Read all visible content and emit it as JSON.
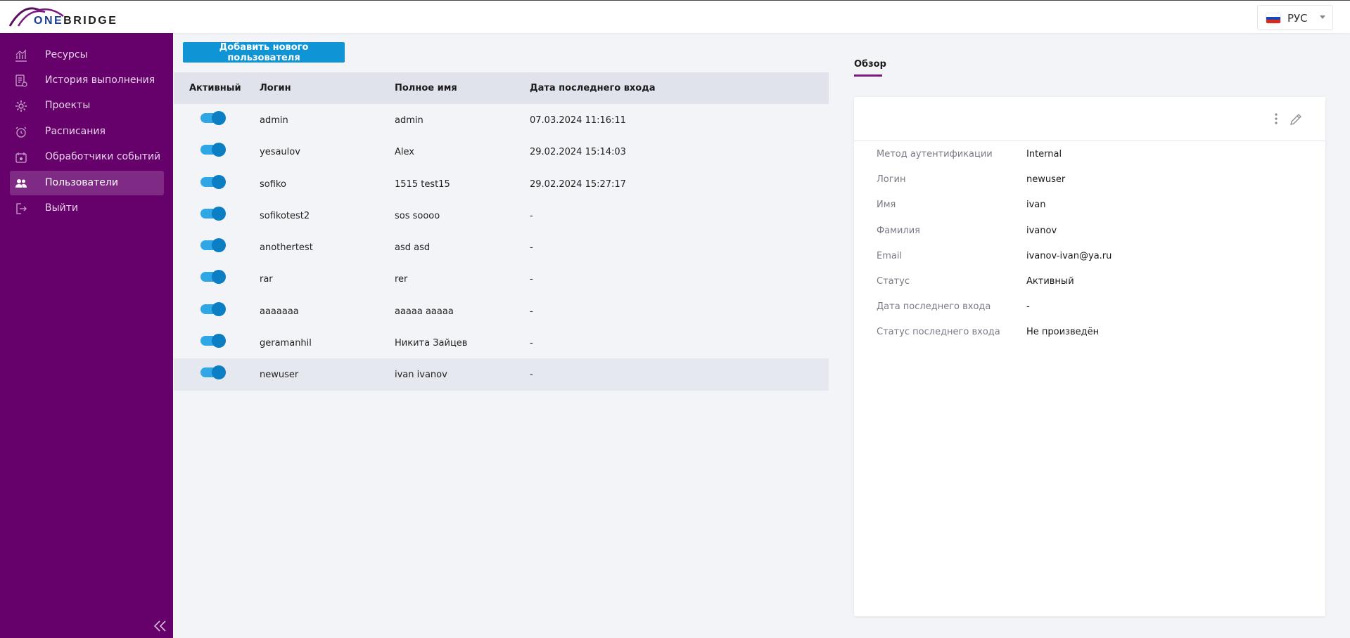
{
  "app": {
    "logo_one": "ONE",
    "logo_bridge": "BRIDGE"
  },
  "language": {
    "label": "РУС"
  },
  "sidebar": {
    "items": [
      {
        "label": "Ресурсы",
        "icon": "chart-icon"
      },
      {
        "label": "История выполнения",
        "icon": "history-icon"
      },
      {
        "label": "Проекты",
        "icon": "gear-icon"
      },
      {
        "label": "Расписания",
        "icon": "alarm-clock-icon"
      },
      {
        "label": "Обработчики событий",
        "icon": "event-icon"
      },
      {
        "label": "Пользователи",
        "icon": "users-icon",
        "active": true
      },
      {
        "label": "Выйти",
        "icon": "logout-icon"
      }
    ]
  },
  "toolbar": {
    "add_user_label": "Добавить нового пользователя"
  },
  "table": {
    "headers": {
      "active": "Активный",
      "login": "Логин",
      "full_name": "Полное имя",
      "last_login": "Дата последнего входа"
    },
    "rows": [
      {
        "active": true,
        "login": "admin",
        "full_name": "admin",
        "last_login": "07.03.2024 11:16:11"
      },
      {
        "active": true,
        "login": "yesaulov",
        "full_name": "Alex",
        "last_login": "29.02.2024 15:14:03"
      },
      {
        "active": true,
        "login": "sofiko",
        "full_name": "1515 test15",
        "last_login": "29.02.2024 15:27:17"
      },
      {
        "active": true,
        "login": "sofikotest2",
        "full_name": "sos soooo",
        "last_login": "-"
      },
      {
        "active": true,
        "login": "anothertest",
        "full_name": "asd asd",
        "last_login": "-"
      },
      {
        "active": true,
        "login": "rar",
        "full_name": "rer",
        "last_login": "-"
      },
      {
        "active": true,
        "login": "aaaaaaa",
        "full_name": "aaaaa aaaaa",
        "last_login": "-"
      },
      {
        "active": true,
        "login": "geramanhil",
        "full_name": "Никита Зайцев",
        "last_login": "-"
      },
      {
        "active": true,
        "login": "newuser",
        "full_name": "ivan ivanov",
        "last_login": "-",
        "selected": true
      }
    ]
  },
  "details": {
    "tab_label": "Обзор",
    "fields": [
      {
        "label": "Метод аутентификации",
        "value": "Internal"
      },
      {
        "label": "Логин",
        "value": "newuser"
      },
      {
        "label": "Имя",
        "value": "ivan"
      },
      {
        "label": "Фамилия",
        "value": "ivanov"
      },
      {
        "label": "Email",
        "value": "ivanov-ivan@ya.ru"
      },
      {
        "label": "Статус",
        "value": "Активный"
      },
      {
        "label": "Дата последнего входа",
        "value": "-"
      },
      {
        "label": "Статус последнего входа",
        "value": "Не произведён"
      }
    ]
  },
  "colors": {
    "sidebar": "#66006b",
    "sidebar_active": "#7f2b85",
    "primary_button": "#0f95d6",
    "toggle_on": "#2fa6e6",
    "tab_accent": "#7a1a80"
  }
}
